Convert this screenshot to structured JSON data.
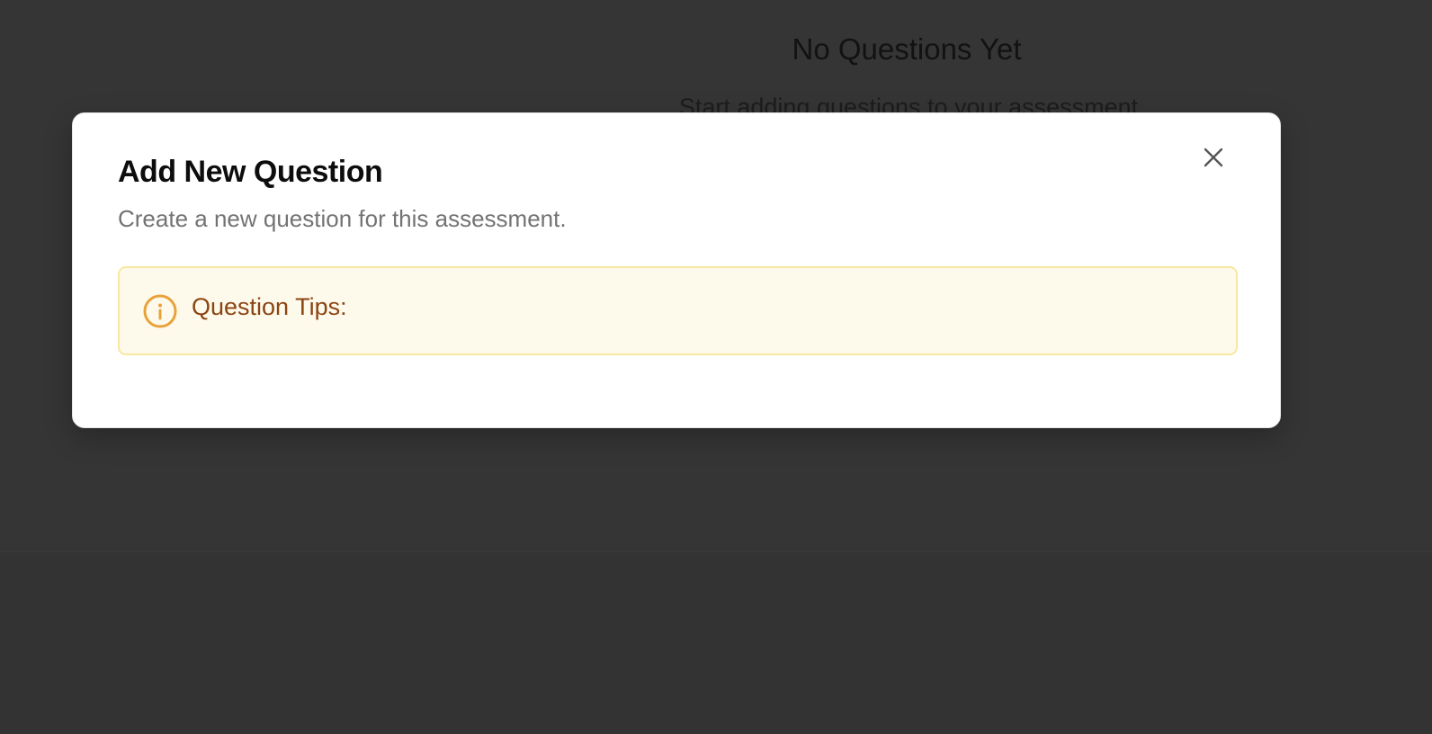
{
  "background_page": {
    "empty_state_title": "No Questions Yet",
    "empty_state_subtitle": "Start adding questions to your assessment"
  },
  "modal": {
    "title": "Add New Question",
    "description": "Create a new question for this assessment.",
    "close_icon": "close-icon",
    "tips": {
      "icon": "info-icon",
      "title": "Question Tips:",
      "accent_color": "#e9a23b",
      "text_color": "#8b4513"
    }
  }
}
